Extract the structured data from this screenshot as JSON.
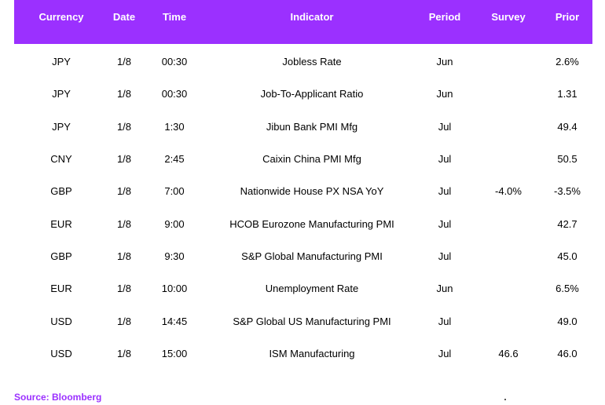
{
  "table": {
    "columns": [
      "Currency",
      "Date",
      "Time",
      "Indicator",
      "Period",
      "Survey",
      "Prior"
    ],
    "rows": [
      {
        "currency": "JPY",
        "date": "1/8",
        "time": "00:30",
        "indicator": "Jobless Rate",
        "period": "Jun",
        "survey": "",
        "prior": "2.6%"
      },
      {
        "currency": "JPY",
        "date": "1/8",
        "time": "00:30",
        "indicator": "Job-To-Applicant Ratio",
        "period": "Jun",
        "survey": "",
        "prior": "1.31"
      },
      {
        "currency": "JPY",
        "date": "1/8",
        "time": "1:30",
        "indicator": "Jibun Bank PMI Mfg",
        "period": "Jul",
        "survey": "",
        "prior": "49.4"
      },
      {
        "currency": "CNY",
        "date": "1/8",
        "time": "2:45",
        "indicator": "Caixin China PMI Mfg",
        "period": "Jul",
        "survey": "",
        "prior": "50.5"
      },
      {
        "currency": "GBP",
        "date": "1/8",
        "time": "7:00",
        "indicator": "Nationwide House PX NSA YoY",
        "period": "Jul",
        "survey": "-4.0%",
        "prior": "-3.5%"
      },
      {
        "currency": "EUR",
        "date": "1/8",
        "time": "9:00",
        "indicator": "HCOB Eurozone Manufacturing PMI",
        "period": "Jul",
        "survey": "",
        "prior": "42.7"
      },
      {
        "currency": "GBP",
        "date": "1/8",
        "time": "9:30",
        "indicator": "S&P Global Manufacturing PMI",
        "period": "Jul",
        "survey": "",
        "prior": "45.0"
      },
      {
        "currency": "EUR",
        "date": "1/8",
        "time": "10:00",
        "indicator": "Unemployment Rate",
        "period": "Jun",
        "survey": "",
        "prior": "6.5%"
      },
      {
        "currency": "USD",
        "date": "1/8",
        "time": "14:45",
        "indicator": "S&P Global US Manufacturing PMI",
        "period": "Jul",
        "survey": "",
        "prior": "49.0"
      },
      {
        "currency": "USD",
        "date": "1/8",
        "time": "15:00",
        "indicator": "ISM Manufacturing",
        "period": "Jul",
        "survey": "46.6",
        "prior": "46.0"
      }
    ]
  },
  "source": "Source: Bloomberg",
  "colors": {
    "header_bg": "#9b30ff",
    "source_text": "#9b30ff"
  }
}
